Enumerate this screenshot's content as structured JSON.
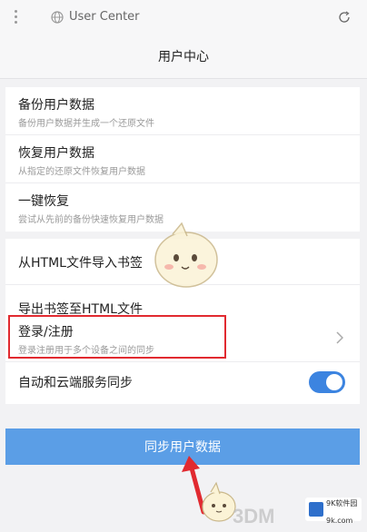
{
  "topbar": {
    "url_text": "User Center",
    "icons": [
      "more-vertical-icon",
      "globe-icon",
      "refresh-icon"
    ]
  },
  "header": {
    "title": "用户中心"
  },
  "backup_group": [
    {
      "title": "备份用户数据",
      "subtitle": "备份用户数据并生成一个还原文件"
    },
    {
      "title": "恢复用户数据",
      "subtitle": "从指定的还原文件恢复用户数据"
    },
    {
      "title": "一键恢复",
      "subtitle": "尝试从先前的备份快速恢复用户数据"
    }
  ],
  "bookmark_group": [
    {
      "title": "从HTML文件导入书签"
    },
    {
      "title": "导出书签至HTML文件"
    }
  ],
  "account_group": {
    "login": {
      "title": "登录/注册",
      "subtitle": "登录注册用于多个设备之间的同步"
    },
    "cloud_sync": {
      "title": "自动和云端服务同步",
      "enabled": true
    }
  },
  "sync_button": {
    "label": "同步用户数据"
  },
  "colors": {
    "accent": "#3c84e0",
    "button": "#5b9ee6",
    "highlight": "#e12a30",
    "background": "#f2f2f4"
  },
  "watermark": {
    "text": "3DM",
    "logo_line1": "9K软件园",
    "logo_line2": "9k.com"
  }
}
